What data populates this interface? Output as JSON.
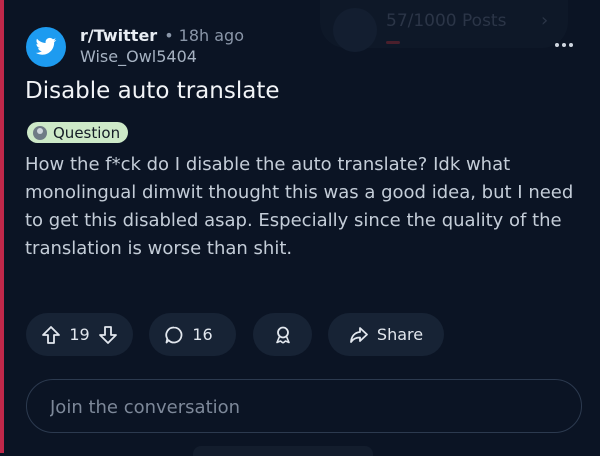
{
  "overlay": {
    "posts_progress": "57/1000 Posts"
  },
  "post": {
    "subreddit": "r/Twitter",
    "separator": "•",
    "time": "18h ago",
    "author": "Wise_Owl5404",
    "title": "Disable auto translate",
    "flair": "Question",
    "body": "How the f*ck do I disable the auto translate? Idk what monolingual dimwit thought this was a good idea, but I need to get this disabled asap. Especially since the quality of the translation is worse than shit."
  },
  "actions": {
    "upvotes": "19",
    "comments": "16",
    "share_label": "Share"
  },
  "composer": {
    "placeholder": "Join the conversation"
  },
  "colors": {
    "background": "#0b1424",
    "accent_bar": "#c0284a",
    "avatar": "#1d9bf0",
    "flair": "#cde9c8",
    "button": "#172335"
  },
  "icons": [
    "more-icon",
    "twitter-bird-icon",
    "upvote-icon",
    "downvote-icon",
    "comment-icon",
    "award-icon",
    "share-icon",
    "chevron-right-icon"
  ]
}
